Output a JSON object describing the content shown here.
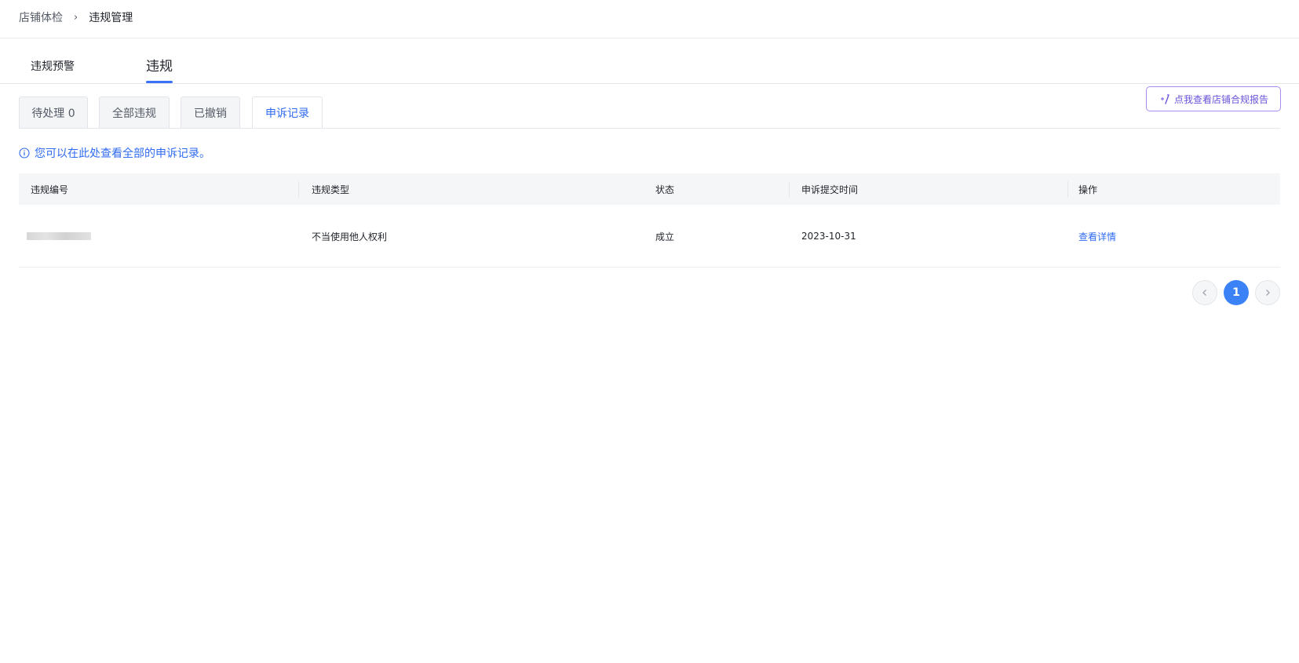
{
  "breadcrumb": {
    "root": "店铺体检",
    "separator": "›",
    "current": "违规管理"
  },
  "main_tabs": [
    {
      "label": "违规预警",
      "active": false
    },
    {
      "label": "违规",
      "active": true
    }
  ],
  "sub_tabs": [
    {
      "label": "待处理 0",
      "active": false
    },
    {
      "label": "全部违规",
      "active": false
    },
    {
      "label": "已撤销",
      "active": false
    },
    {
      "label": "申诉记录",
      "active": true
    }
  ],
  "compliance_report": {
    "label": "点我查看店铺合规报告",
    "icon": "sparkle-wand-icon"
  },
  "notice": {
    "icon": "info-circle-icon",
    "text": "您可以在此处查看全部的申诉记录。"
  },
  "table": {
    "columns": [
      "违规编号",
      "违规类型",
      "状态",
      "申诉提交时间",
      "操作"
    ],
    "rows": [
      {
        "id_masked": true,
        "type": "不当使用他人权利",
        "status": "成立",
        "submit_time": "2023-10-31",
        "action": "查看详情"
      }
    ]
  },
  "pagination": {
    "current_page": "1",
    "prev_icon": "chevron-left-icon",
    "next_icon": "chevron-right-icon"
  },
  "colors": {
    "primary": "#3b82f6",
    "link": "#2f6bf0",
    "report_border": "#a98cf2"
  }
}
